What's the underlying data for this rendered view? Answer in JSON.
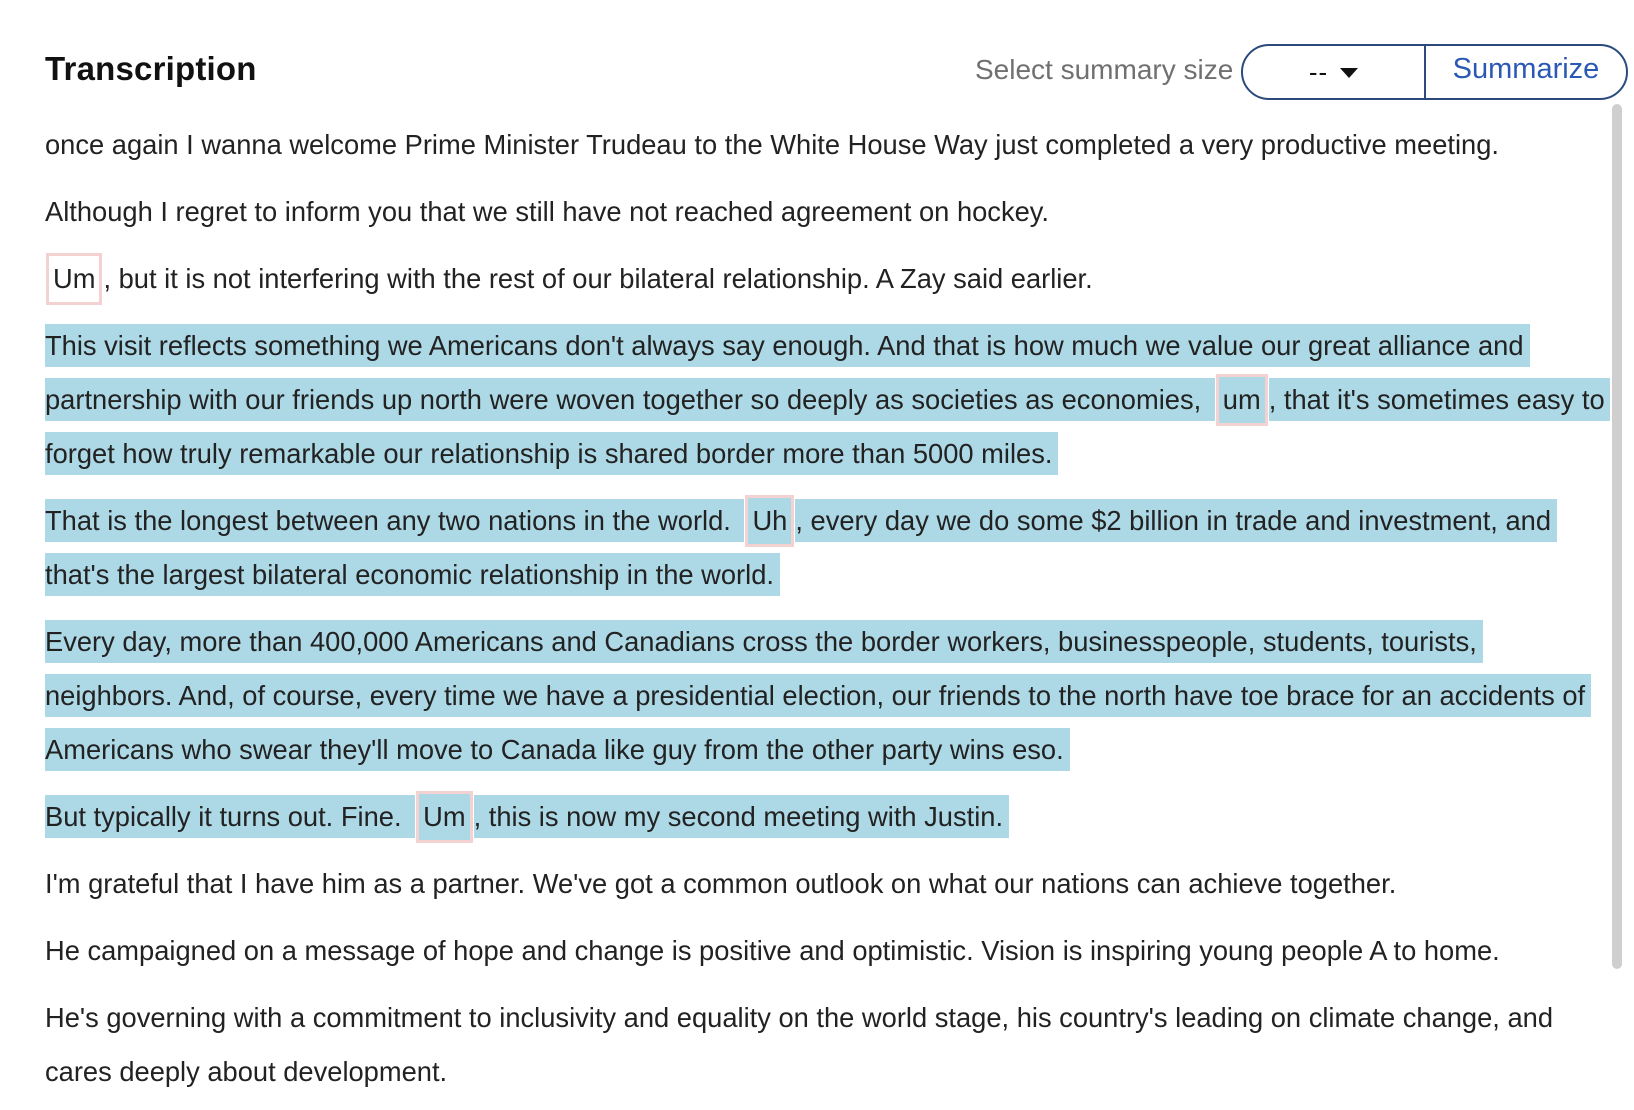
{
  "header": {
    "title": "Transcription",
    "size_label": "Select summary size",
    "size_value": "--",
    "summarize_label": "Summarize"
  },
  "transcript": {
    "paragraphs": [
      {
        "selected": false,
        "segments": [
          {
            "t": "once again I wanna welcome Prime Minister Trudeau to the White House Way just completed a very productive meeting."
          }
        ]
      },
      {
        "selected": false,
        "segments": [
          {
            "t": "Although I regret to inform you that we still have not reached agreement on hockey."
          }
        ]
      },
      {
        "selected": false,
        "segments": [
          {
            "filler": "Um"
          },
          {
            "t": ", but it is not interfering with the rest of our bilateral relationship. A Zay said earlier."
          }
        ]
      },
      {
        "selected": true,
        "segments": [
          {
            "t": "This visit reflects something we Americans don't always say enough. And that is how much we value our great alliance and partnership with our friends up north were woven together so deeply as societies as economies, "
          },
          {
            "filler": "um"
          },
          {
            "t": ", that it's sometimes easy to forget how truly remarkable our relationship is shared border more than 5000 miles."
          }
        ]
      },
      {
        "selected": true,
        "segments": [
          {
            "t": "That is the longest between any two nations in the world. "
          },
          {
            "filler": "Uh"
          },
          {
            "t": ", every day we do some $2 billion in trade and investment, and that's the largest bilateral economic relationship in the world."
          }
        ]
      },
      {
        "selected": true,
        "segments": [
          {
            "t": "Every day, more than 400,000 Americans and Canadians cross the border workers, businesspeople, students, tourists, neighbors. And, of course, every time we have a presidential election, our friends to the north have toe brace for an accidents of Americans who swear they'll move to Canada like guy from the other party wins eso."
          }
        ]
      },
      {
        "selected": true,
        "segments": [
          {
            "t": "But typically it turns out. Fine. "
          },
          {
            "filler": "Um"
          },
          {
            "t": ", this is now my second meeting with Justin."
          }
        ]
      },
      {
        "selected": false,
        "segments": [
          {
            "t": "I'm grateful that I have him as a partner. We've got a common outlook on what our nations can achieve together."
          }
        ]
      },
      {
        "selected": false,
        "segments": [
          {
            "t": "He campaigned on a message of hope and change is positive and optimistic. Vision is inspiring young people A to home."
          }
        ]
      },
      {
        "selected": false,
        "segments": [
          {
            "t": "He's governing with a commitment to inclusivity and equality on the world stage, his country's leading on climate change, and cares deeply about development."
          }
        ]
      }
    ]
  },
  "colors": {
    "selection": "#add8e6",
    "filler_border": "#f5d2d2",
    "accent": "#2b58b5",
    "control_border": "#2c4a7e"
  },
  "icons": {
    "dropdown": "caret-down-icon"
  }
}
